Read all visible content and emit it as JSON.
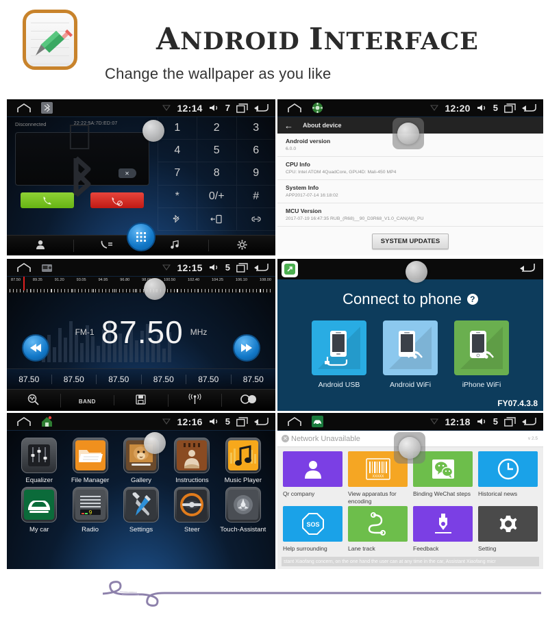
{
  "header": {
    "title_first_letter": "A",
    "title_part1": "NDROID ",
    "title_second_letter": "I",
    "title_part2": "NTERFACE",
    "subtitle": "Change the wallpaper as you like",
    "logo_icon": "notepad-pencil-icon"
  },
  "panels": {
    "bluetooth": {
      "status_bar": {
        "home_icon": "home-icon",
        "app_icon": "bluetooth-app-icon",
        "wifi_icon": "wifi-icon",
        "time": "12:14",
        "volume_icon": "volume-icon",
        "volume_level": "7",
        "recents_icon": "recents-icon",
        "back_icon": "back-icon"
      },
      "connection_status": "Disconnected",
      "mac_address": "22:22:5A:7D:ED:07",
      "bluetooth_glyph_icon": "bluetooth-icon",
      "delete_label": "✕",
      "call_button_icon": "phone-call-icon",
      "hangup_button_icon": "phone-hangup-icon",
      "keys": [
        "1",
        "2",
        "3",
        "4",
        "5",
        "6",
        "7",
        "8",
        "9",
        "*",
        "0/+",
        "#"
      ],
      "extra_keys": [
        "bluetooth-toggle-icon",
        "transfer-audio-icon",
        "link-icon"
      ],
      "dock": [
        "contacts-icon",
        "call-log-icon",
        "music-icon",
        "settings-icon"
      ],
      "fab_icon": "dialpad-icon"
    },
    "about_device": {
      "status_bar": {
        "home_icon": "home-icon",
        "app_icon": "settings-app-icon",
        "wifi_icon": "wifi-icon",
        "time": "12:20",
        "volume_icon": "volume-icon",
        "volume_level": "5",
        "recents_icon": "recents-icon",
        "back_icon": "back-icon"
      },
      "back_arrow": "←",
      "title": "About device",
      "rows": [
        {
          "key": "Android version",
          "value": "6.0.0"
        },
        {
          "key": "CPU Info",
          "value": "CPU: Intel ATOM 4QuadCore, GPU4D: Mali-450 MP4"
        },
        {
          "key": "System Info",
          "value": "APP2017-07-14 16:18:02"
        },
        {
          "key": "MCU Version",
          "value": "2017-07-19 16:47:35 RUB_(R68)__90_D3R68_V1.0_CAN(All)_PU"
        }
      ],
      "updates_button": "SYSTEM UPDATES"
    },
    "radio": {
      "status_bar": {
        "home_icon": "home-icon",
        "app_icon": "radio-app-icon",
        "wifi_icon": "wifi-icon",
        "time": "12:15",
        "volume_icon": "volume-icon",
        "volume_level": "5",
        "recents_icon": "recents-icon",
        "back_icon": "back-icon"
      },
      "scale_labels": [
        "87.50",
        "89.35",
        "91.20",
        "93.05",
        "94.95",
        "96.80",
        "98.65",
        "100.50",
        "102.40",
        "104.25",
        "106.10",
        "108.00"
      ],
      "band": "FM-1",
      "frequency": "87.50",
      "unit": "MHz",
      "prev_icon": "rewind-icon",
      "next_icon": "forward-icon",
      "presets": [
        "87.50",
        "87.50",
        "87.50",
        "87.50",
        "87.50",
        "87.50"
      ],
      "dock": [
        "scan-icon",
        "BAND",
        "save-icon",
        "rds-icon",
        "stereo-icon"
      ]
    },
    "connect_to_phone": {
      "badge_icon": "mirror-link-app-icon",
      "back_icon": "back-icon",
      "title": "Connect to phone",
      "help_badge": "?",
      "tiles": [
        {
          "label": "Android USB",
          "color": "#29ace3",
          "icon": "phone-usb-cable-icon"
        },
        {
          "label": "Android WiFi",
          "color": "#8cc8ee",
          "icon": "phone-wifi-icon"
        },
        {
          "label": "iPhone WiFi",
          "color": "#6aaf4f",
          "icon": "iphone-wifi-icon"
        }
      ],
      "version": "FY07.4.3.8"
    },
    "app_grid": {
      "status_bar": {
        "home_icon": "home-icon",
        "app_icon": "launcher-app-icon",
        "wifi_icon": "wifi-icon",
        "time": "12:16",
        "volume_icon": "volume-icon",
        "volume_level": "5",
        "recents_icon": "recents-icon",
        "back_icon": "back-icon"
      },
      "apps": [
        {
          "label": "Equalizer",
          "icon": "equalizer-icon"
        },
        {
          "label": "File Manager",
          "icon": "folder-icon"
        },
        {
          "label": "Gallery",
          "icon": "gallery-lion-icon"
        },
        {
          "label": "Instructions",
          "icon": "instructions-book-icon"
        },
        {
          "label": "Music Player",
          "icon": "music-note-icon"
        },
        {
          "label": "My car",
          "icon": "car-icon"
        },
        {
          "label": "Radio",
          "icon": "radio-tuner-icon"
        },
        {
          "label": "Settings",
          "icon": "wrench-screwdriver-icon"
        },
        {
          "label": "Steer",
          "icon": "steering-wheel-icon"
        },
        {
          "label": "Touch-Assistant",
          "icon": "touch-assistant-icon"
        }
      ]
    },
    "xiaofang": {
      "status_bar": {
        "home_icon": "home-icon",
        "app_icon": "xiaofang-app-icon",
        "wifi_icon": "wifi-icon",
        "time": "12:18",
        "volume_icon": "volume-icon",
        "volume_level": "5",
        "recents_icon": "recents-icon",
        "back_icon": "back-icon"
      },
      "network_status": "Network Unavailable",
      "network_close_icon": "✕",
      "version": "v 2.5",
      "tiles": [
        {
          "label": "Qr company",
          "color": "#7b3fe4",
          "icon": "person-icon"
        },
        {
          "label": "View apparatus for encoding",
          "color": "#f5a623",
          "icon": "barcode-icon"
        },
        {
          "label": "Binding WeChat steps",
          "color": "#6dbe4b",
          "icon": "wechat-icon"
        },
        {
          "label": "Historical news",
          "color": "#1aa2e8",
          "icon": "clock-icon"
        },
        {
          "label": "Help surrounding",
          "color": "#1aa2e8",
          "icon": "sos-icon"
        },
        {
          "label": "Lane track",
          "color": "#6dbe4b",
          "icon": "route-icon"
        },
        {
          "label": "Feedback",
          "color": "#7b3fe4",
          "icon": "pen-icon"
        },
        {
          "label": "Setting",
          "color": "#4a4a4a",
          "icon": "gear-icon"
        }
      ],
      "ticker": "stant Xiaofang concern, on the one hand the user can at any time in the car, Assistant Xiaofang micr"
    }
  },
  "footer": {
    "divider_icon": "purple-swirl-divider"
  }
}
